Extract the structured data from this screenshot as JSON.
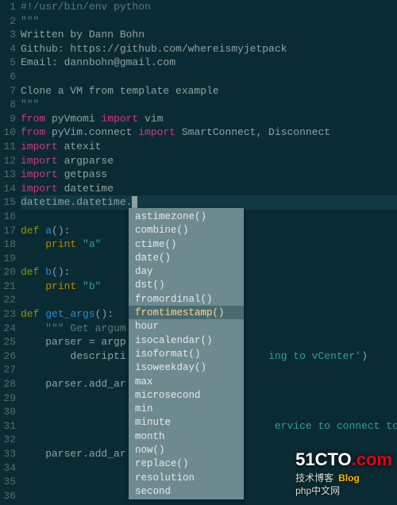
{
  "lines": [
    {
      "n": 1,
      "tokens": [
        {
          "c": "comment",
          "t": "#!/usr/bin/env python"
        }
      ]
    },
    {
      "n": 2,
      "tokens": [
        {
          "c": "docstr",
          "t": "\"\"\""
        }
      ]
    },
    {
      "n": 3,
      "tokens": [
        {
          "c": "var",
          "t": "Written by Dann Bohn"
        }
      ]
    },
    {
      "n": 4,
      "tokens": [
        {
          "c": "var",
          "t": "Github: https://github.com/whereismyjetpack"
        }
      ]
    },
    {
      "n": 5,
      "tokens": [
        {
          "c": "var",
          "t": "Email: dannbohn@gmail.com"
        }
      ]
    },
    {
      "n": 6,
      "tokens": []
    },
    {
      "n": 7,
      "tokens": [
        {
          "c": "var",
          "t": "Clone a VM from template example"
        }
      ]
    },
    {
      "n": 8,
      "tokens": [
        {
          "c": "docstr",
          "t": "\"\"\""
        }
      ]
    },
    {
      "n": 9,
      "tokens": [
        {
          "c": "kw-import",
          "t": "from "
        },
        {
          "c": "var",
          "t": "pyVmomi "
        },
        {
          "c": "kw-import",
          "t": "import "
        },
        {
          "c": "var",
          "t": "vim"
        }
      ]
    },
    {
      "n": 10,
      "tokens": [
        {
          "c": "kw-import",
          "t": "from "
        },
        {
          "c": "var",
          "t": "pyVim.connect "
        },
        {
          "c": "kw-import",
          "t": "import "
        },
        {
          "c": "var",
          "t": "SmartConnect, Disconnect"
        }
      ]
    },
    {
      "n": 11,
      "tokens": [
        {
          "c": "kw-import",
          "t": "import "
        },
        {
          "c": "var",
          "t": "atexit"
        }
      ]
    },
    {
      "n": 12,
      "tokens": [
        {
          "c": "kw-import",
          "t": "import "
        },
        {
          "c": "var",
          "t": "argparse"
        }
      ]
    },
    {
      "n": 13,
      "tokens": [
        {
          "c": "kw-import",
          "t": "import "
        },
        {
          "c": "var",
          "t": "getpass"
        }
      ]
    },
    {
      "n": 14,
      "tokens": [
        {
          "c": "kw-import",
          "t": "import "
        },
        {
          "c": "var",
          "t": "datetime"
        }
      ]
    },
    {
      "n": 15,
      "cursor": true,
      "tokens": [
        {
          "c": "var",
          "t": "datetime.datetime."
        }
      ]
    },
    {
      "n": 16,
      "tokens": []
    },
    {
      "n": 17,
      "tokens": [
        {
          "c": "kw-def",
          "t": "def "
        },
        {
          "c": "func",
          "t": "a"
        },
        {
          "c": "paren",
          "t": "():"
        }
      ]
    },
    {
      "n": 18,
      "tokens": [
        {
          "c": "var",
          "t": "    "
        },
        {
          "c": "ident",
          "t": "print "
        },
        {
          "c": "string",
          "t": "\"a\""
        },
        {
          "c": "var",
          "t": "    "
        }
      ]
    },
    {
      "n": 19,
      "tokens": []
    },
    {
      "n": 20,
      "tokens": [
        {
          "c": "kw-def",
          "t": "def "
        },
        {
          "c": "func",
          "t": "b"
        },
        {
          "c": "paren",
          "t": "():"
        }
      ]
    },
    {
      "n": 21,
      "tokens": [
        {
          "c": "var",
          "t": "    "
        },
        {
          "c": "ident",
          "t": "print "
        },
        {
          "c": "string",
          "t": "\"b\""
        },
        {
          "c": "var",
          "t": "    "
        }
      ]
    },
    {
      "n": 22,
      "tokens": []
    },
    {
      "n": 23,
      "tokens": [
        {
          "c": "kw-def",
          "t": "def "
        },
        {
          "c": "func",
          "t": "get_args"
        },
        {
          "c": "paren",
          "t": "():    "
        }
      ]
    },
    {
      "n": 24,
      "tokens": [
        {
          "c": "docstr",
          "t": "    \"\"\" Get argum"
        }
      ]
    },
    {
      "n": 25,
      "tokens": [
        {
          "c": "var",
          "t": "    parser = argp"
        }
      ]
    },
    {
      "n": 26,
      "tokens": [
        {
          "c": "var",
          "t": "        descripti                       "
        },
        {
          "c": "string",
          "t": "ing to vCenter'"
        },
        {
          "c": "paren",
          "t": ")"
        }
      ]
    },
    {
      "n": 27,
      "tokens": []
    },
    {
      "n": 28,
      "tokens": [
        {
          "c": "var",
          "t": "    parser.add_ar"
        }
      ]
    },
    {
      "n": 29,
      "tokens": []
    },
    {
      "n": 30,
      "tokens": []
    },
    {
      "n": 31,
      "tokens": [
        {
          "c": "var",
          "t": "                                         "
        },
        {
          "c": "string",
          "t": "ervice to connect to'"
        },
        {
          "c": "paren",
          "t": ")"
        }
      ]
    },
    {
      "n": 32,
      "tokens": []
    },
    {
      "n": 33,
      "tokens": [
        {
          "c": "var",
          "t": "    parser.add_ar"
        }
      ]
    },
    {
      "n": 34,
      "tokens": []
    },
    {
      "n": 35,
      "tokens": []
    },
    {
      "n": 36,
      "tokens": []
    }
  ],
  "autocomplete": {
    "items": [
      {
        "label": "astimezone()",
        "sel": false
      },
      {
        "label": "combine()",
        "sel": false
      },
      {
        "label": "ctime()",
        "sel": false
      },
      {
        "label": "date()",
        "sel": false
      },
      {
        "label": "day",
        "sel": false
      },
      {
        "label": "dst()",
        "sel": false
      },
      {
        "label": "fromordinal()",
        "sel": false
      },
      {
        "label": "fromtimestamp()",
        "sel": true
      },
      {
        "label": "hour",
        "sel": false
      },
      {
        "label": "isocalendar()",
        "sel": false
      },
      {
        "label": "isoformat()",
        "sel": false
      },
      {
        "label": "isoweekday()",
        "sel": false
      },
      {
        "label": "max",
        "sel": false
      },
      {
        "label": "microsecond",
        "sel": false
      },
      {
        "label": "min",
        "sel": false
      },
      {
        "label": "minute",
        "sel": false
      },
      {
        "label": "month",
        "sel": false
      },
      {
        "label": "now()",
        "sel": false
      },
      {
        "label": "replace()",
        "sel": false
      },
      {
        "label": "resolution",
        "sel": false
      },
      {
        "label": "second",
        "sel": false
      }
    ]
  },
  "watermark": {
    "brand_main": "51CTO",
    "brand_suffix": ".com",
    "sub": "技术博客",
    "blog": "Blog",
    "php": "php中文网"
  }
}
